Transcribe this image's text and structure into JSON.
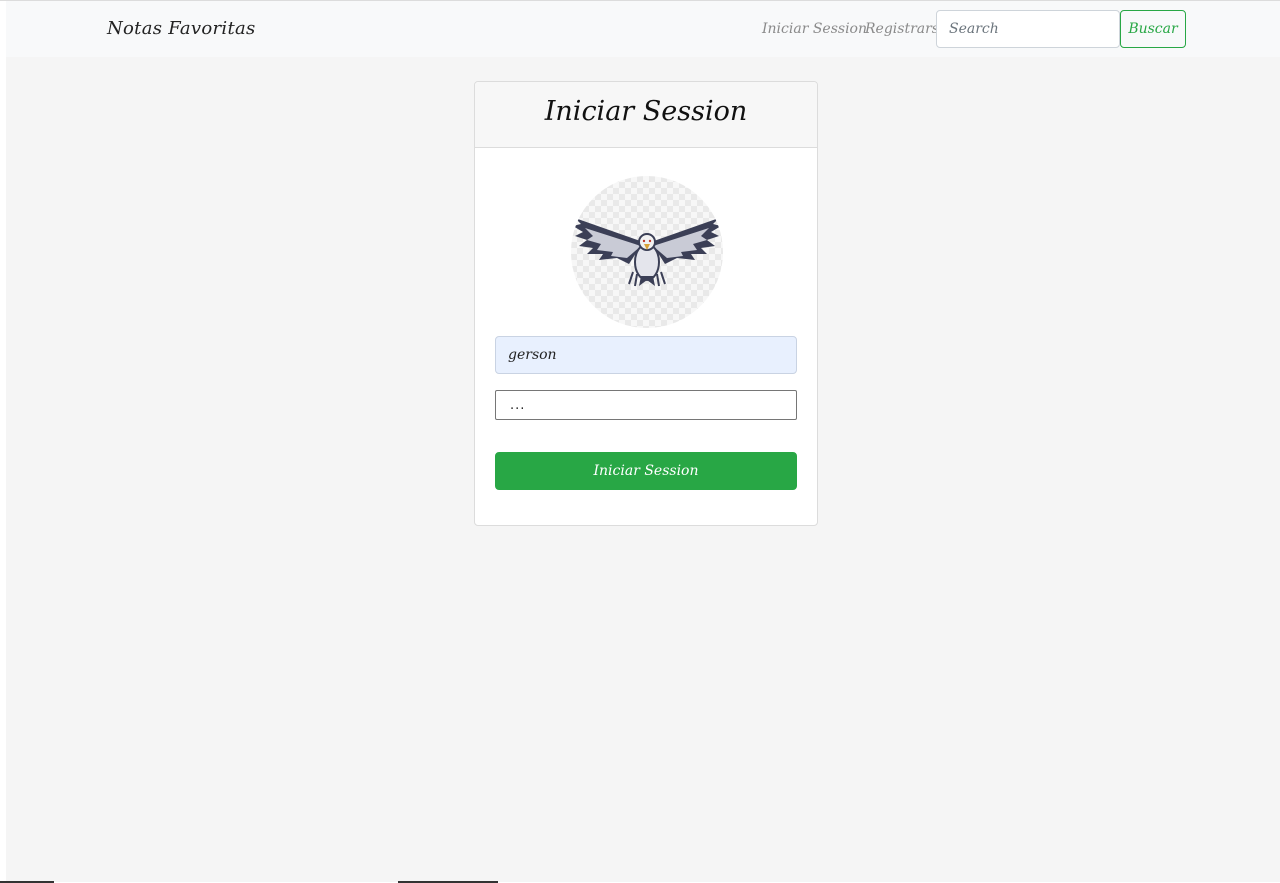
{
  "navbar": {
    "brand": "Notas Favoritas",
    "links": {
      "login": "Iniciar Session",
      "register": "Registrarse"
    },
    "search": {
      "placeholder": "Search",
      "button": "Buscar"
    }
  },
  "login_card": {
    "title": "Iniciar Session",
    "username_value": "gerson",
    "password_value": "...",
    "submit_label": "Iniciar Session"
  },
  "colors": {
    "accent": "#28a745",
    "navbar_bg": "#f8f9fa",
    "page_bg": "#f5f5f5",
    "autofill_bg": "#e8f0fe"
  },
  "icons": {
    "avatar": "eagle-logo-icon"
  }
}
